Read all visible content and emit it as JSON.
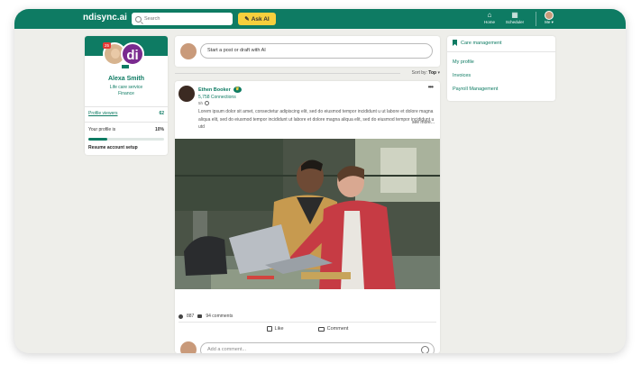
{
  "nav": {
    "brand": "ndisync.ai",
    "search_placeholder": "Search",
    "ask_ai_label": "Ask AI",
    "home_label": "Home",
    "scheduler_label": "Scheduler",
    "me_label": "Me"
  },
  "profile": {
    "badge_count": "25",
    "logo_text": "di",
    "name": "Alexa Smith",
    "title": "Life care service",
    "department": "Finance",
    "viewers_label": "Profile viewers",
    "viewers_count": "62",
    "completion_label": "Your profile is",
    "completion_value": "10%",
    "completion_fraction": 0.25,
    "resume_label": "Resume account setup"
  },
  "composer": {
    "placeholder": "Start a post or draft with AI"
  },
  "feed": {
    "sort_label": "Sort by:",
    "sort_value": "Top"
  },
  "post": {
    "author": "Ethen Booker",
    "connections": "5,758 Connections",
    "time": "5h",
    "text": "Lorem ipsum dolor sit amet, consectetur adipiscing elit, sed do eiusmod tempor incididunt u ut labore et dolore magna aliqua elit, sed do eiusmod tempor incididunt ut labore et dolore magna aliqua elit, sed do eiusmod tempor incididunt u utd",
    "see_more": "see more...",
    "reactions": "887",
    "comments": "94 comments",
    "like_label": "Like",
    "comment_label": "Comment",
    "add_comment_placeholder": "Add a comment..."
  },
  "menu": {
    "header": "Care management",
    "items": [
      "My profile",
      "Invoices",
      "Payroll Management"
    ]
  },
  "colors": {
    "brand": "#0e7b63",
    "accent": "#f6cf3d"
  }
}
